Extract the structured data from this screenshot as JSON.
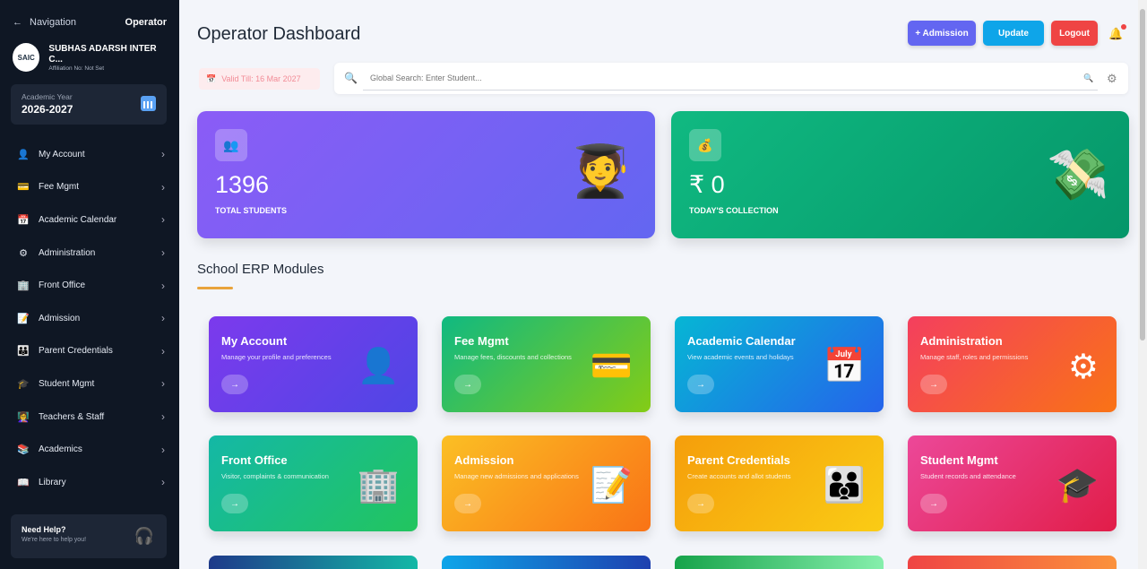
{
  "sidebar": {
    "nav_label": "Navigation",
    "role": "Operator",
    "school_name": "SUBHAS ADARSH INTER C...",
    "affiliation": "Affiliation No: Not Set",
    "year_label": "Academic Year",
    "year_value": "2026-2027",
    "items": [
      {
        "label": "My Account",
        "icon": "👤"
      },
      {
        "label": "Fee Mgmt",
        "icon": "💳"
      },
      {
        "label": "Academic Calendar",
        "icon": "📅"
      },
      {
        "label": "Administration",
        "icon": "⚙"
      },
      {
        "label": "Front Office",
        "icon": "🏢"
      },
      {
        "label": "Admission",
        "icon": "📝"
      },
      {
        "label": "Parent Credentials",
        "icon": "👪"
      },
      {
        "label": "Student Mgmt",
        "icon": "🎓"
      },
      {
        "label": "Teachers & Staff",
        "icon": "👩‍🏫"
      },
      {
        "label": "Academics",
        "icon": "📚"
      },
      {
        "label": "Library",
        "icon": "📖"
      }
    ],
    "help_title": "Need Help?",
    "help_sub": "We're here to help you!"
  },
  "header": {
    "title": "Operator Dashboard",
    "admission_btn": "+ Admission",
    "update_btn": "Update",
    "logout_btn": "Logout",
    "valid_till": "Valid Till: 16 Mar 2027",
    "search_placeholder": "Global Search: Enter Student..."
  },
  "stats": [
    {
      "value": "1396",
      "label": "TOTAL STUDENTS"
    },
    {
      "value": "₹ 0",
      "label": "TODAY'S COLLECTION"
    }
  ],
  "section_title": "School ERP Modules",
  "modules": [
    {
      "title": "My Account",
      "desc": "Manage your profile and preferences",
      "icon": "👤"
    },
    {
      "title": "Fee Mgmt",
      "desc": "Manage fees, discounts and collections",
      "icon": "💳"
    },
    {
      "title": "Academic Calendar",
      "desc": "View academic events and holidays",
      "icon": "📅"
    },
    {
      "title": "Administration",
      "desc": "Manage staff, roles and permissions",
      "icon": "⚙"
    },
    {
      "title": "Front Office",
      "desc": "Visitor, complaints & communication",
      "icon": "🏢"
    },
    {
      "title": "Admission",
      "desc": "Manage new admissions and applications",
      "icon": "📝"
    },
    {
      "title": "Parent Credentials",
      "desc": "Create accounts and allot students",
      "icon": "👪"
    },
    {
      "title": "Student Mgmt",
      "desc": "Student records and attendance",
      "icon": "🎓"
    }
  ],
  "colors": {
    "sidebar_bg": "#0f1724",
    "admission_btn": "#6366f1",
    "update_btn": "#0ea5e9",
    "logout_btn": "#ef4444"
  }
}
